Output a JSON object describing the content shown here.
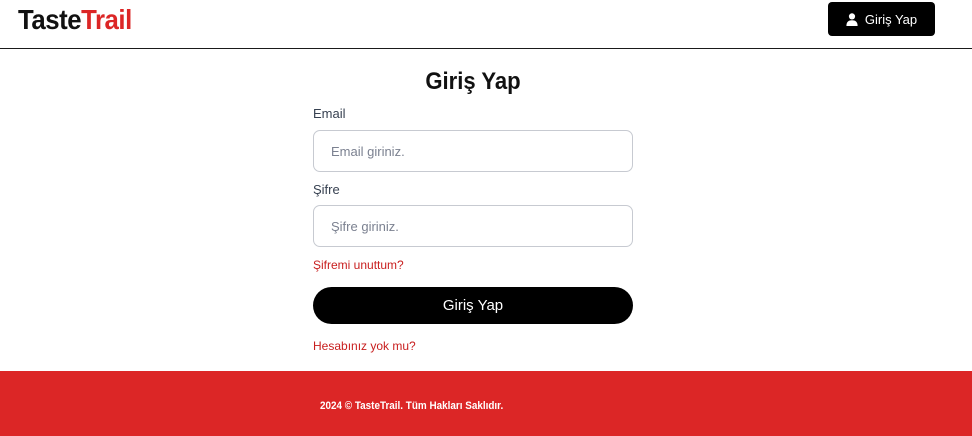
{
  "header": {
    "logo_part1": "Taste",
    "logo_part2": "Trail",
    "login_button_label": "Giriş Yap",
    "login_button_icon": "user-icon"
  },
  "form": {
    "title": "Giriş Yap",
    "email_label": "Email",
    "email_placeholder": "Email giriniz.",
    "email_value": "",
    "password_label": "Şifre",
    "password_placeholder": "Şifre giriniz.",
    "password_value": "",
    "forgot_password": "Şifremi unuttum?",
    "submit_label": "Giriş Yap",
    "no_account": "Hesabınız yok mu?"
  },
  "footer": {
    "copyright": "2024 © TasteTrail. Tüm Hakları Saklıdır."
  },
  "colors": {
    "brand_red": "#dc2626",
    "button_black": "#000000"
  }
}
